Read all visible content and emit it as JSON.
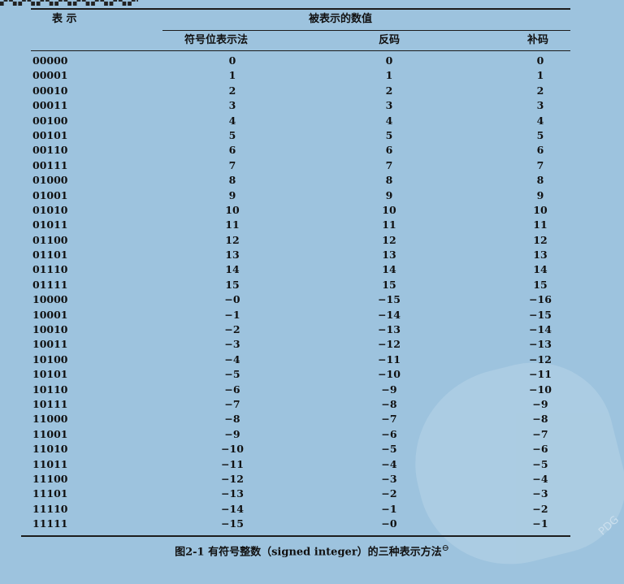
{
  "header": {
    "col_repr": "表  示",
    "group": "被表示的数值",
    "col_signmag": "符号位表示法",
    "col_ones": "反码",
    "col_twos": "补码"
  },
  "rows": [
    {
      "bits": "00000",
      "signmag": "0",
      "ones": "0",
      "twos": "0"
    },
    {
      "bits": "00001",
      "signmag": "1",
      "ones": "1",
      "twos": "1"
    },
    {
      "bits": "00010",
      "signmag": "2",
      "ones": "2",
      "twos": "2"
    },
    {
      "bits": "00011",
      "signmag": "3",
      "ones": "3",
      "twos": "3"
    },
    {
      "bits": "00100",
      "signmag": "4",
      "ones": "4",
      "twos": "4"
    },
    {
      "bits": "00101",
      "signmag": "5",
      "ones": "5",
      "twos": "5"
    },
    {
      "bits": "00110",
      "signmag": "6",
      "ones": "6",
      "twos": "6"
    },
    {
      "bits": "00111",
      "signmag": "7",
      "ones": "7",
      "twos": "7"
    },
    {
      "bits": "01000",
      "signmag": "8",
      "ones": "8",
      "twos": "8"
    },
    {
      "bits": "01001",
      "signmag": "9",
      "ones": "9",
      "twos": "9"
    },
    {
      "bits": "01010",
      "signmag": "10",
      "ones": "10",
      "twos": "10"
    },
    {
      "bits": "01011",
      "signmag": "11",
      "ones": "11",
      "twos": "11"
    },
    {
      "bits": "01100",
      "signmag": "12",
      "ones": "12",
      "twos": "12"
    },
    {
      "bits": "01101",
      "signmag": "13",
      "ones": "13",
      "twos": "13"
    },
    {
      "bits": "01110",
      "signmag": "14",
      "ones": "14",
      "twos": "14"
    },
    {
      "bits": "01111",
      "signmag": "15",
      "ones": "15",
      "twos": "15"
    },
    {
      "bits": "10000",
      "signmag": "−0",
      "ones": "−15",
      "twos": "−16"
    },
    {
      "bits": "10001",
      "signmag": "−1",
      "ones": "−14",
      "twos": "−15"
    },
    {
      "bits": "10010",
      "signmag": "−2",
      "ones": "−13",
      "twos": "−14"
    },
    {
      "bits": "10011",
      "signmag": "−3",
      "ones": "−12",
      "twos": "−13"
    },
    {
      "bits": "10100",
      "signmag": "−4",
      "ones": "−11",
      "twos": "−12"
    },
    {
      "bits": "10101",
      "signmag": "−5",
      "ones": "−10",
      "twos": "−11"
    },
    {
      "bits": "10110",
      "signmag": "−6",
      "ones": "−9",
      "twos": "−10"
    },
    {
      "bits": "10111",
      "signmag": "−7",
      "ones": "−8",
      "twos": "−9"
    },
    {
      "bits": "11000",
      "signmag": "−8",
      "ones": "−7",
      "twos": "−8"
    },
    {
      "bits": "11001",
      "signmag": "−9",
      "ones": "−6",
      "twos": "−7"
    },
    {
      "bits": "11010",
      "signmag": "−10",
      "ones": "−5",
      "twos": "−6"
    },
    {
      "bits": "11011",
      "signmag": "−11",
      "ones": "−4",
      "twos": "−5"
    },
    {
      "bits": "11100",
      "signmag": "−12",
      "ones": "−3",
      "twos": "−4"
    },
    {
      "bits": "11101",
      "signmag": "−13",
      "ones": "−2",
      "twos": "−3"
    },
    {
      "bits": "11110",
      "signmag": "−14",
      "ones": "−1",
      "twos": "−2"
    },
    {
      "bits": "11111",
      "signmag": "−15",
      "ones": "−0",
      "twos": "−1"
    }
  ],
  "caption": {
    "text": "图2-1  有符号整数（signed integer）的三种表示方法",
    "footnote_mark": "⊖"
  },
  "watermark": {
    "text": "PDG"
  }
}
